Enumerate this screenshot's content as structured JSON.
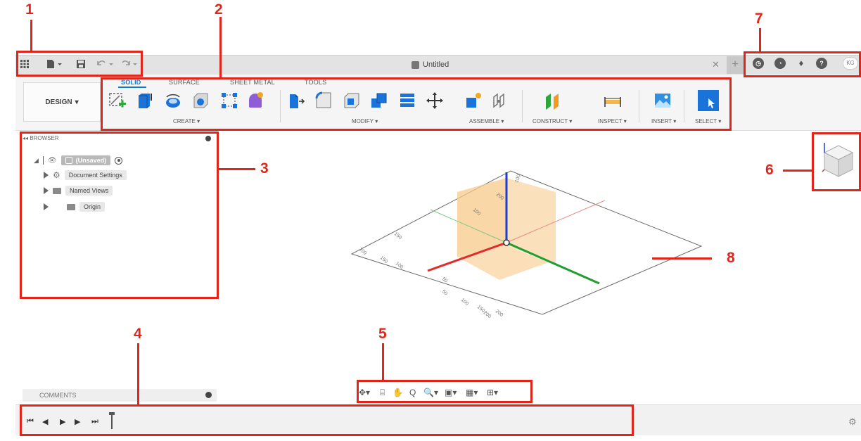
{
  "callouts": [
    "1",
    "2",
    "3",
    "4",
    "5",
    "6",
    "7",
    "8"
  ],
  "document": {
    "title": "Untitled"
  },
  "quick_access": {
    "icons": [
      "grid-menu-icon",
      "file-menu-icon",
      "save-icon",
      "undo-icon",
      "redo-icon"
    ]
  },
  "help_bar": {
    "icons": [
      "job-status-icon",
      "clock-icon",
      "notification-icon",
      "help-icon"
    ],
    "avatar_initials": "KG"
  },
  "workspace": {
    "label": "DESIGN"
  },
  "toolbar_tabs": [
    {
      "label": "SOLID",
      "active": true
    },
    {
      "label": "SURFACE",
      "active": false
    },
    {
      "label": "SHEET METAL",
      "active": false
    },
    {
      "label": "TOOLS",
      "active": false
    }
  ],
  "toolbar_groups": {
    "create": "CREATE",
    "modify": "MODIFY",
    "assemble": "ASSEMBLE",
    "construct": "CONSTRUCT",
    "inspect": "INSPECT",
    "insert": "INSERT",
    "select": "SELECT"
  },
  "browser": {
    "title": "BROWSER",
    "root": "(Unsaved)",
    "items": [
      "Document Settings",
      "Named Views",
      "Origin"
    ]
  },
  "comments": {
    "title": "COMMENTS"
  },
  "timeline": {
    "controls": [
      "first-icon",
      "previous-icon",
      "play-icon",
      "next-icon",
      "last-icon",
      "marker-icon"
    ]
  },
  "grid_labels": [
    "100",
    "200",
    "100",
    "150",
    "200",
    "50",
    "100",
    "150",
    "200",
    "50",
    "100",
    "150",
    "200"
  ],
  "colors": {
    "annotation": "#e0251b",
    "accent": "#0b7bd3",
    "x_axis": "#e32b2b",
    "y_axis": "#1f9e2f",
    "z_axis": "#1d3fcc",
    "plane": "#f7c98a"
  }
}
